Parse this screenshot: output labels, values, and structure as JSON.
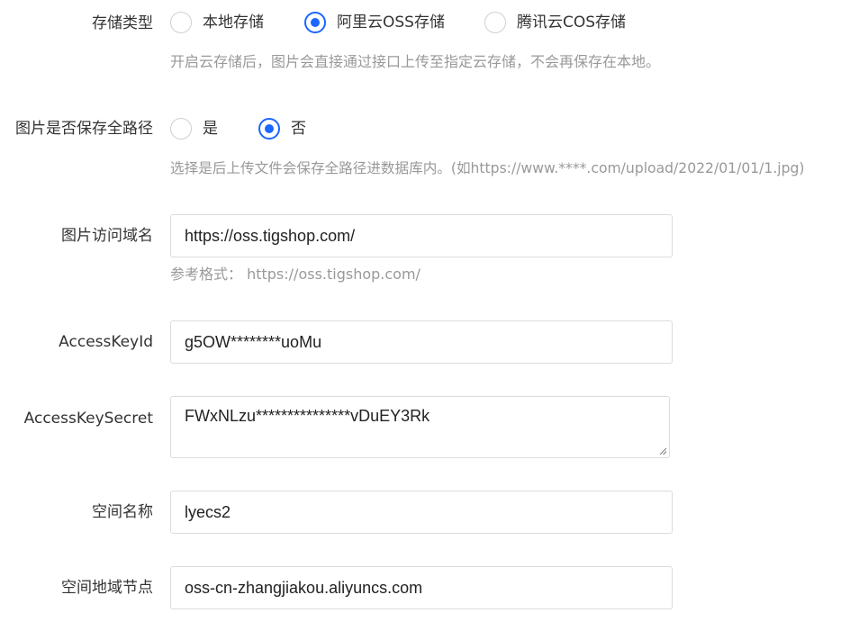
{
  "storage_type": {
    "label": "存储类型",
    "options": [
      "本地存储",
      "阿里云OSS存储",
      "腾讯云COS存储"
    ],
    "selected": "阿里云OSS存储",
    "hint": "开启云存储后，图片会直接通过接口上传至指定云存储，不会再保存在本地。"
  },
  "full_path": {
    "label": "图片是否保存全路径",
    "options": [
      "是",
      "否"
    ],
    "selected": "否",
    "hint": "选择是后上传文件会保存全路径进数据库内。(如https://www.****.com/upload/2022/01/01/1.jpg)"
  },
  "domain": {
    "label": "图片访问域名",
    "value": "https://oss.tigshop.com/",
    "hint": "参考格式： https://oss.tigshop.com/"
  },
  "access_key_id": {
    "label": "AccessKeyId",
    "value": "g5OW********uoMu"
  },
  "access_key_secret": {
    "label": "AccessKeySecret",
    "value": "FWxNLzu***************vDuEY3Rk"
  },
  "bucket": {
    "label": "空间名称",
    "value": "lyecs2"
  },
  "region": {
    "label": "空间地域节点",
    "value": "oss-cn-zhangjiakou.aliyuncs.com"
  },
  "colors": {
    "accent": "#1a66ff",
    "hint_text": "#999999",
    "border": "#dcdcdc"
  }
}
